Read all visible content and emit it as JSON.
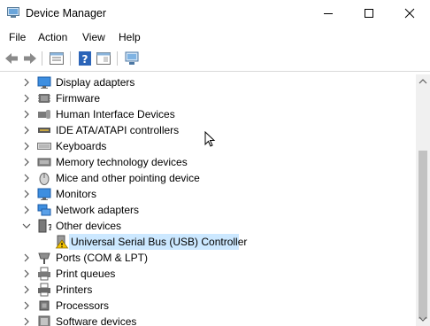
{
  "window": {
    "title": "Device Manager"
  },
  "menu": [
    {
      "label": "File"
    },
    {
      "label": "Action"
    },
    {
      "label": "View"
    },
    {
      "label": "Help"
    }
  ],
  "tree": [
    {
      "label": "Display adapters",
      "icon": "display-adapter-icon"
    },
    {
      "label": "Firmware",
      "icon": "firmware-icon"
    },
    {
      "label": "Human Interface Devices",
      "icon": "hid-icon"
    },
    {
      "label": "IDE ATA/ATAPI controllers",
      "icon": "ide-controller-icon"
    },
    {
      "label": "Keyboards",
      "icon": "keyboard-icon"
    },
    {
      "label": "Memory technology devices",
      "icon": "memory-device-icon"
    },
    {
      "label": "Mice and other pointing device",
      "icon": "mouse-icon"
    },
    {
      "label": "Monitors",
      "icon": "monitor-icon"
    },
    {
      "label": "Network adapters",
      "icon": "network-adapter-icon"
    },
    {
      "label": "Other devices",
      "icon": "other-devices-icon",
      "expanded": true
    },
    {
      "label": "Universal Serial Bus (USB) Controller",
      "icon": "warning-device-icon",
      "child": true,
      "selected": true
    },
    {
      "label": "Ports (COM & LPT)",
      "icon": "port-icon"
    },
    {
      "label": "Print queues",
      "icon": "print-queue-icon"
    },
    {
      "label": "Printers",
      "icon": "printer-icon"
    },
    {
      "label": "Processors",
      "icon": "processor-icon"
    },
    {
      "label": "Software devices",
      "icon": "software-device-icon"
    }
  ],
  "colors": {
    "selection": "#cce8ff",
    "accent": "#1e78c8",
    "warning": "#f5c400"
  }
}
